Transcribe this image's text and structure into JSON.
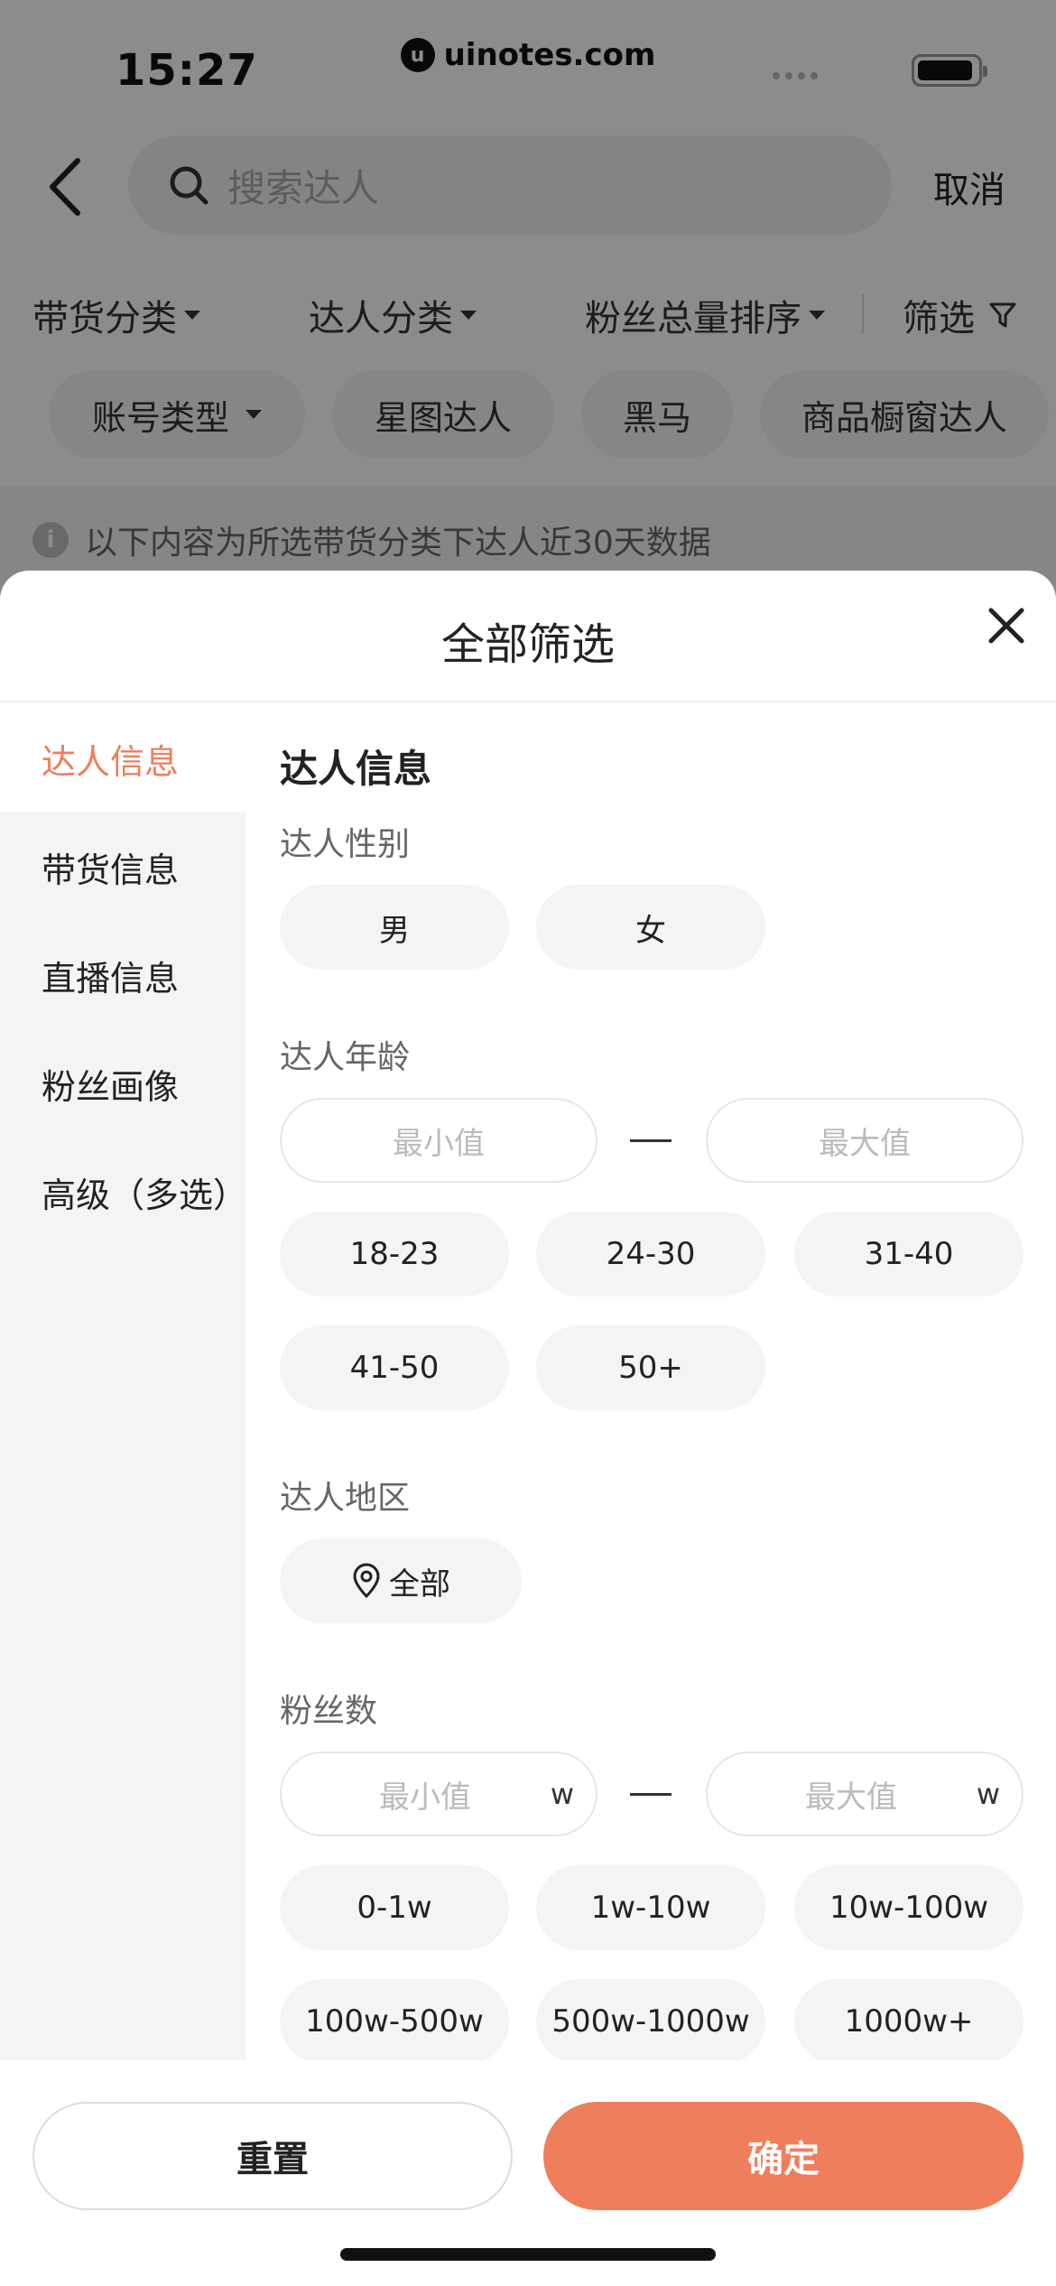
{
  "status_bar": {
    "time": "15:27",
    "watermark": "uinotes.com"
  },
  "search": {
    "placeholder": "搜索达人",
    "cancel_label": "取消"
  },
  "filter_tabs": [
    {
      "label": "带货分类"
    },
    {
      "label": "达人分类"
    },
    {
      "label": "粉丝总量排序"
    },
    {
      "label": "筛选"
    }
  ],
  "quick_chips": [
    {
      "label": "账号类型"
    },
    {
      "label": "星图达人"
    },
    {
      "label": "黑马"
    },
    {
      "label": "商品橱窗达人"
    }
  ],
  "notice": {
    "text": "以下内容为所选带货分类下达人近30天数据"
  },
  "sheet": {
    "title": "全部筛选",
    "sidebar": [
      {
        "label": "达人信息",
        "active": true
      },
      {
        "label": "带货信息"
      },
      {
        "label": "直播信息"
      },
      {
        "label": "粉丝画像"
      },
      {
        "label": "高级（多选）"
      }
    ],
    "section_title": "达人信息",
    "gender": {
      "label": "达人性别",
      "options": [
        "男",
        "女"
      ]
    },
    "age": {
      "label": "达人年龄",
      "min_placeholder": "最小值",
      "max_placeholder": "最大值",
      "options": [
        "18-23",
        "24-30",
        "31-40",
        "41-50",
        "50+"
      ]
    },
    "region": {
      "label": "达人地区",
      "value": "全部"
    },
    "fans": {
      "label": "粉丝数",
      "min_placeholder": "最小值",
      "max_placeholder": "最大值",
      "unit": "w",
      "options": [
        "0-1w",
        "1w-10w",
        "10w-100w",
        "100w-500w",
        "500w-1000w",
        "1000w+"
      ]
    },
    "reset_label": "重置",
    "confirm_label": "确定"
  },
  "colors": {
    "accent": "#ef7e5c",
    "chip_bg": "#f4f4f4",
    "overlay": "rgba(0,0,0,0.45)"
  }
}
